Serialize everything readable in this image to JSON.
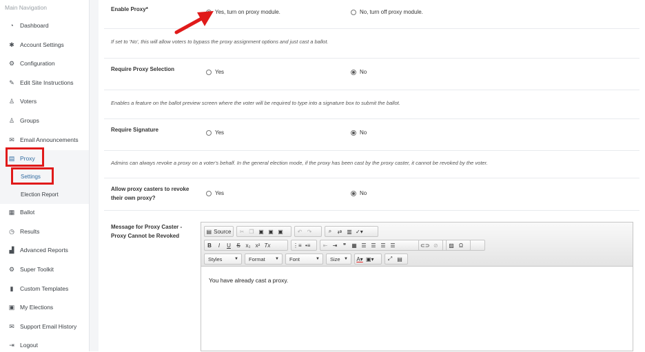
{
  "sidebar": {
    "heading": "Main Navigation",
    "items": [
      {
        "label": "Dashboard",
        "icon": "dashboard-icon",
        "glyph": "◔"
      },
      {
        "label": "Account Settings",
        "icon": "gear-icon",
        "glyph": "✱"
      },
      {
        "label": "Configuration",
        "icon": "gears-icon",
        "glyph": "⚙"
      },
      {
        "label": "Edit Site Instructions",
        "icon": "pencil-icon",
        "glyph": "✎"
      },
      {
        "label": "Voters",
        "icon": "user-icon",
        "glyph": "♙"
      },
      {
        "label": "Groups",
        "icon": "users-icon",
        "glyph": "♙"
      },
      {
        "label": "Email Announcements",
        "icon": "envelope-icon",
        "glyph": "✉"
      },
      {
        "label": "Proxy",
        "icon": "list-icon",
        "glyph": "▤"
      },
      {
        "label": "Ballot",
        "icon": "ballot-icon",
        "glyph": "▦"
      },
      {
        "label": "Results",
        "icon": "clock-icon",
        "glyph": "◷"
      },
      {
        "label": "Advanced Reports",
        "icon": "chart-icon",
        "glyph": "▟"
      },
      {
        "label": "Super Toolkit",
        "icon": "cogs-icon",
        "glyph": "⚙"
      },
      {
        "label": "Custom Templates",
        "icon": "file-icon",
        "glyph": "▮"
      },
      {
        "label": "My Elections",
        "icon": "calendar-icon",
        "glyph": "▣"
      },
      {
        "label": "Support Email History",
        "icon": "envelope-icon",
        "glyph": "✉"
      },
      {
        "label": "Logout",
        "icon": "sign-out-icon",
        "glyph": "⇥"
      }
    ],
    "proxy_sub": [
      {
        "label": "Settings"
      },
      {
        "label": "Election Report"
      }
    ]
  },
  "form": {
    "enable_proxy": {
      "label": "Enable Proxy*",
      "option_yes": "Yes, turn on proxy module.",
      "option_no": "No, turn off proxy module.",
      "selected": "yes",
      "help": "If set to 'No', this will allow voters to bypass the proxy assignment options and just cast a ballot."
    },
    "require_selection": {
      "label": "Require Proxy Selection",
      "option_yes": "Yes",
      "option_no": "No",
      "selected": "no",
      "help": "Enables a feature on the ballot preview screen where the voter will be required to type into a signature box to submit the ballot."
    },
    "require_signature": {
      "label": "Require Signature",
      "option_yes": "Yes",
      "option_no": "No",
      "selected": "no",
      "help": "Admins can always revoke a proxy on a voter's behalf. In the general election mode, if the proxy has been cast by the proxy caster, it cannot be revoked by the voter."
    },
    "allow_revoke": {
      "label_line1": "Allow proxy casters to revoke",
      "label_line2": "their own proxy?",
      "option_yes": "Yes",
      "option_no": "No",
      "selected": "no"
    },
    "message": {
      "label_line1": "Message for Proxy Caster -",
      "label_line2": "Proxy Cannot be Revoked",
      "value": "You have already cast a proxy."
    }
  },
  "editor": {
    "source_label": "Source",
    "combos": {
      "styles": "Styles",
      "format": "Format",
      "font": "Font",
      "size": "Size"
    }
  },
  "annotation_color": "#e01a1a"
}
